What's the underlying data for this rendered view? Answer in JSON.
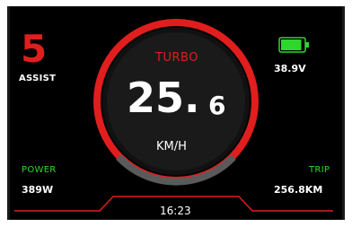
{
  "assist": {
    "level": "5",
    "label": "ASSIST"
  },
  "battery": {
    "voltage": "38.9V",
    "charge_level": 0.9,
    "icon": "battery-icon",
    "color": "#2ed62e"
  },
  "speed": {
    "mode": "TURBO",
    "integer": "25.",
    "decimal": "6",
    "unit": "KM/H"
  },
  "power": {
    "label": "POWER",
    "value": "389W"
  },
  "trip": {
    "label": "TRIP",
    "value": "256.8KM"
  },
  "clock": {
    "time": "16:23"
  },
  "colors": {
    "accent": "#e01e1e",
    "positive": "#2ed62e",
    "background": "#000000",
    "text": "#ffffff"
  }
}
